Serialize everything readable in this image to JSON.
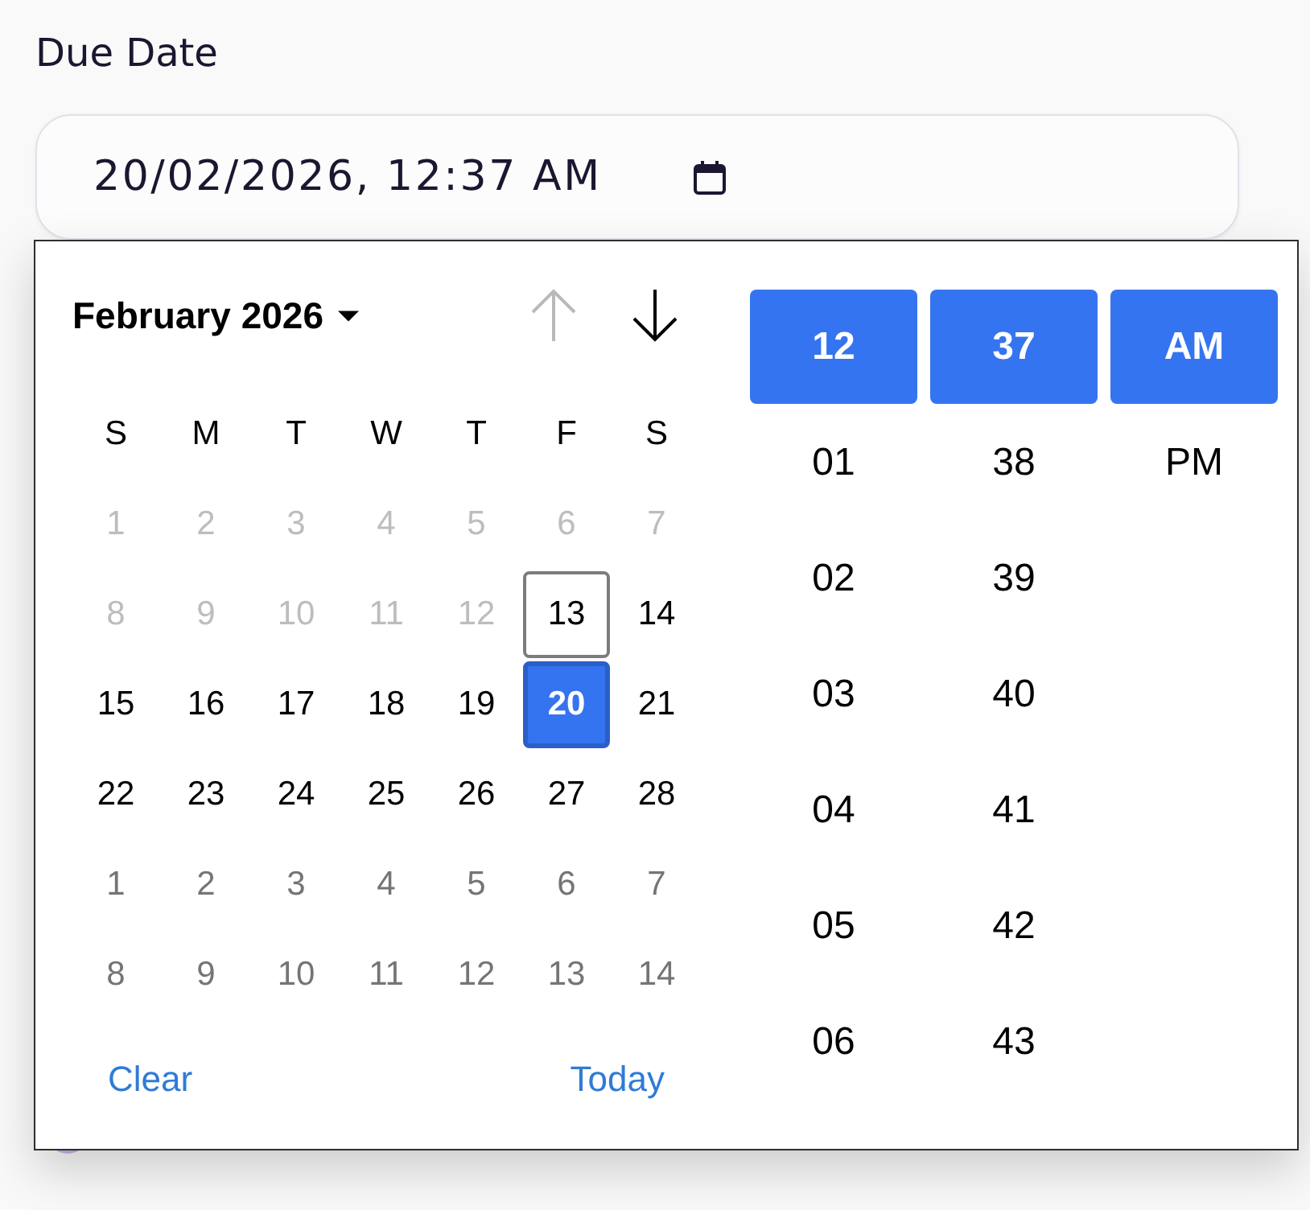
{
  "field": {
    "label": "Due Date",
    "value": "20/02/2026, 12:37 AM"
  },
  "calendar": {
    "title": "February 2026",
    "nav": [
      {
        "kind": "up",
        "disabled": true
      },
      {
        "kind": "down",
        "disabled": false
      }
    ],
    "weekdays": [
      "S",
      "M",
      "T",
      "W",
      "T",
      "F",
      "S"
    ],
    "weeks": [
      {
        "days": [
          {
            "label": "1",
            "kind": "disabled",
            "selected": false,
            "today": false
          },
          {
            "label": "2",
            "kind": "disabled",
            "selected": false,
            "today": false
          },
          {
            "label": "3",
            "kind": "disabled",
            "selected": false,
            "today": false
          },
          {
            "label": "4",
            "kind": "disabled",
            "selected": false,
            "today": false
          },
          {
            "label": "5",
            "kind": "disabled",
            "selected": false,
            "today": false
          },
          {
            "label": "6",
            "kind": "disabled",
            "selected": false,
            "today": false
          },
          {
            "label": "7",
            "kind": "disabled",
            "selected": false,
            "today": false
          }
        ]
      },
      {
        "days": [
          {
            "label": "8",
            "kind": "disabled",
            "selected": false,
            "today": false
          },
          {
            "label": "9",
            "kind": "disabled",
            "selected": false,
            "today": false
          },
          {
            "label": "10",
            "kind": "disabled",
            "selected": false,
            "today": false
          },
          {
            "label": "11",
            "kind": "disabled",
            "selected": false,
            "today": false
          },
          {
            "label": "12",
            "kind": "disabled",
            "selected": false,
            "today": false
          },
          {
            "label": "13",
            "kind": "current",
            "selected": false,
            "today": true
          },
          {
            "label": "14",
            "kind": "current",
            "selected": false,
            "today": false
          }
        ]
      },
      {
        "days": [
          {
            "label": "15",
            "kind": "current",
            "selected": false,
            "today": false
          },
          {
            "label": "16",
            "kind": "current",
            "selected": false,
            "today": false
          },
          {
            "label": "17",
            "kind": "current",
            "selected": false,
            "today": false
          },
          {
            "label": "18",
            "kind": "current",
            "selected": false,
            "today": false
          },
          {
            "label": "19",
            "kind": "current",
            "selected": false,
            "today": false
          },
          {
            "label": "20",
            "kind": "current",
            "selected": true,
            "today": false
          },
          {
            "label": "21",
            "kind": "current",
            "selected": false,
            "today": false
          }
        ]
      },
      {
        "days": [
          {
            "label": "22",
            "kind": "current",
            "selected": false,
            "today": false
          },
          {
            "label": "23",
            "kind": "current",
            "selected": false,
            "today": false
          },
          {
            "label": "24",
            "kind": "current",
            "selected": false,
            "today": false
          },
          {
            "label": "25",
            "kind": "current",
            "selected": false,
            "today": false
          },
          {
            "label": "26",
            "kind": "current",
            "selected": false,
            "today": false
          },
          {
            "label": "27",
            "kind": "current",
            "selected": false,
            "today": false
          },
          {
            "label": "28",
            "kind": "current",
            "selected": false,
            "today": false
          }
        ]
      },
      {
        "days": [
          {
            "label": "1",
            "kind": "adjacent",
            "selected": false,
            "today": false
          },
          {
            "label": "2",
            "kind": "adjacent",
            "selected": false,
            "today": false
          },
          {
            "label": "3",
            "kind": "adjacent",
            "selected": false,
            "today": false
          },
          {
            "label": "4",
            "kind": "adjacent",
            "selected": false,
            "today": false
          },
          {
            "label": "5",
            "kind": "adjacent",
            "selected": false,
            "today": false
          },
          {
            "label": "6",
            "kind": "adjacent",
            "selected": false,
            "today": false
          },
          {
            "label": "7",
            "kind": "adjacent",
            "selected": false,
            "today": false
          }
        ]
      },
      {
        "days": [
          {
            "label": "8",
            "kind": "adjacent",
            "selected": false,
            "today": false
          },
          {
            "label": "9",
            "kind": "adjacent",
            "selected": false,
            "today": false
          },
          {
            "label": "10",
            "kind": "adjacent",
            "selected": false,
            "today": false
          },
          {
            "label": "11",
            "kind": "adjacent",
            "selected": false,
            "today": false
          },
          {
            "label": "12",
            "kind": "adjacent",
            "selected": false,
            "today": false
          },
          {
            "label": "13",
            "kind": "adjacent",
            "selected": false,
            "today": false
          },
          {
            "label": "14",
            "kind": "adjacent",
            "selected": false,
            "today": false
          }
        ]
      }
    ],
    "clear_button": "Clear",
    "today_button": "Today"
  },
  "time": {
    "columns": [
      {
        "items": [
          {
            "label": "12",
            "selected": true
          },
          {
            "label": "01",
            "selected": false
          },
          {
            "label": "02",
            "selected": false
          },
          {
            "label": "03",
            "selected": false
          },
          {
            "label": "04",
            "selected": false
          },
          {
            "label": "05",
            "selected": false
          },
          {
            "label": "06",
            "selected": false
          }
        ]
      },
      {
        "items": [
          {
            "label": "37",
            "selected": true
          },
          {
            "label": "38",
            "selected": false
          },
          {
            "label": "39",
            "selected": false
          },
          {
            "label": "40",
            "selected": false
          },
          {
            "label": "41",
            "selected": false
          },
          {
            "label": "42",
            "selected": false
          },
          {
            "label": "43",
            "selected": false
          }
        ]
      },
      {
        "items": [
          {
            "label": "AM",
            "selected": true
          },
          {
            "label": "PM",
            "selected": false
          }
        ]
      }
    ]
  }
}
